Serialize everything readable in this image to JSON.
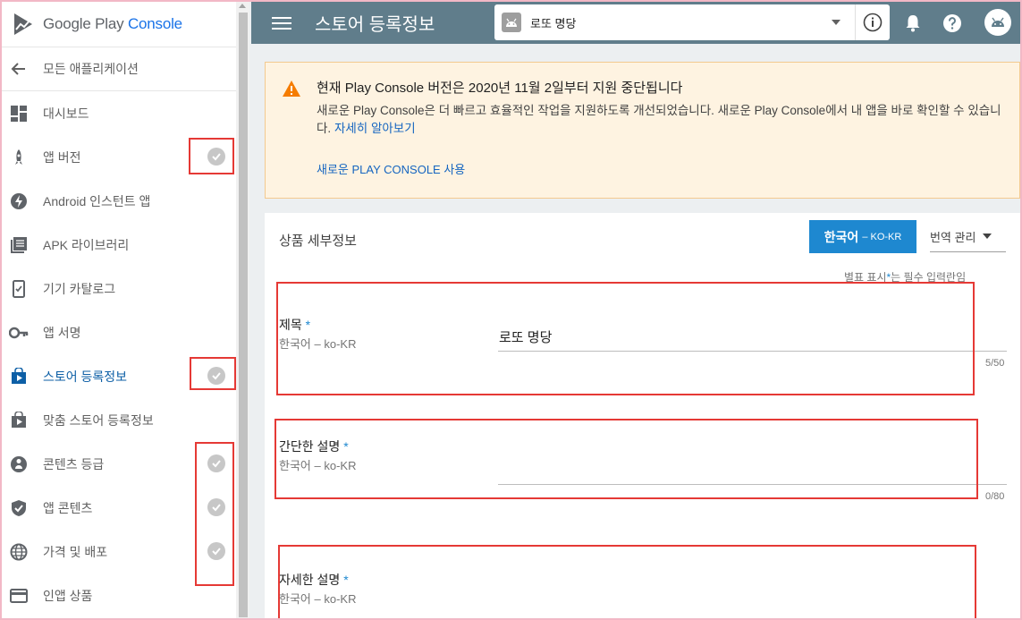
{
  "brand": {
    "logo_google": "Google Play",
    "logo_console": "Console"
  },
  "sidebar": {
    "back_label": "모든 애플리케이션",
    "items": [
      {
        "label": "대시보드",
        "icon": "dashboard-icon",
        "check": false
      },
      {
        "label": "앱 버전",
        "icon": "rocket-icon",
        "check": true
      },
      {
        "label": "Android 인스턴트 앱",
        "icon": "instant-app-icon",
        "check": false
      },
      {
        "label": "APK 라이브러리",
        "icon": "apk-library-icon",
        "check": false
      },
      {
        "label": "기기 카탈로그",
        "icon": "device-catalog-icon",
        "check": false
      },
      {
        "label": "앱 서명",
        "icon": "key-icon",
        "check": false
      },
      {
        "label": "스토어 등록정보",
        "icon": "store-listing-icon",
        "check": true,
        "active": true
      },
      {
        "label": "맞춤 스토어 등록정보",
        "icon": "custom-listing-icon",
        "check": false
      },
      {
        "label": "콘텐츠 등급",
        "icon": "content-rating-icon",
        "check": true
      },
      {
        "label": "앱 콘텐츠",
        "icon": "shield-icon",
        "check": true
      },
      {
        "label": "가격 및 배포",
        "icon": "globe-icon",
        "check": true
      },
      {
        "label": "인앱 상품",
        "icon": "credit-card-icon",
        "check": false
      }
    ]
  },
  "topbar": {
    "title": "스토어 등록정보",
    "app_name": "로또 명당"
  },
  "warning": {
    "title": "현재 Play Console 버전은 2020년 11월 2일부터 지원 중단됩니다",
    "body": "새로운 Play Console은 더 빠르고 효율적인 작업을 지원하도록 개선되었습니다. 새로운 Play Console에서 내 앱을 바로 확인할 수 있습니다.",
    "link": "자세히 알아보기",
    "action": "새로운 PLAY CONSOLE 사용"
  },
  "details": {
    "title": "상품 세부정보",
    "lang_button": "한국어",
    "lang_button_sub": "– KO-KR",
    "translation_button": "번역 관리",
    "required_note_prefix": "별표 표시",
    "required_note_star": "*",
    "required_note_suffix": "는 필수 입력란임",
    "fields": [
      {
        "label": "제목",
        "star": "*",
        "sub": "한국어 – ko-KR",
        "value": "로또 명당",
        "count": "5/50"
      },
      {
        "label": "간단한 설명",
        "star": "*",
        "sub": "한국어 – ko-KR",
        "value": "",
        "count": "0/80"
      },
      {
        "label": "자세한 설명",
        "star": "*",
        "sub": "한국어 – ko-KR",
        "value": "",
        "count": ""
      }
    ]
  },
  "colors": {
    "topbar": "#607d8b",
    "accent": "#1e88d0",
    "warning_bg": "#fef3e1",
    "warning_icon": "#f57c00",
    "annotation": "#e53935"
  }
}
